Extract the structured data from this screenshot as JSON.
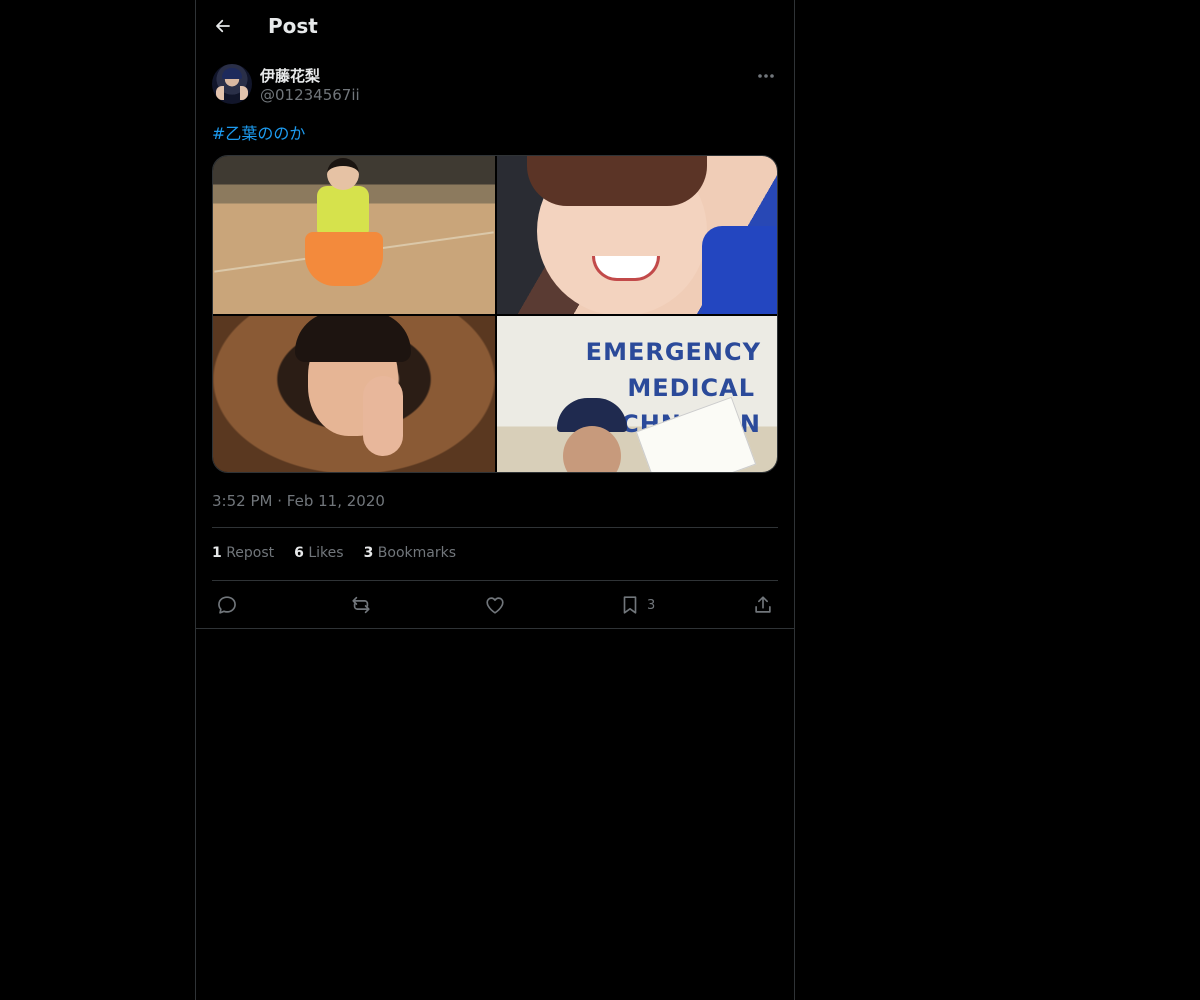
{
  "header": {
    "title": "Post"
  },
  "post": {
    "author": {
      "name": "伊藤花梨",
      "handle": "@01234567ii"
    },
    "hashtag": "#乙葉ののか",
    "media": {
      "photos": [
        {
          "name": "photo-1"
        },
        {
          "name": "photo-2"
        },
        {
          "name": "photo-3"
        },
        {
          "name": "photo-4",
          "visible_text": [
            "EMERGENCY",
            "MEDICAL",
            "ECHNICIAN"
          ]
        }
      ]
    },
    "time": "3:52 PM",
    "separator": "·",
    "date": "Feb 11, 2020",
    "stats": {
      "reposts": {
        "count": "1",
        "label": "Repost"
      },
      "likes": {
        "count": "6",
        "label": "Likes"
      },
      "bookmarks": {
        "count": "3",
        "label": "Bookmarks"
      }
    },
    "actions": {
      "bookmark_count": "3"
    }
  },
  "icons": {
    "back": "arrow-left-icon",
    "more": "more-horizontal-icon",
    "reply": "reply-icon",
    "repost": "repost-icon",
    "like": "heart-icon",
    "bookmark": "bookmark-icon",
    "share": "share-icon"
  },
  "colors": {
    "background": "#000000",
    "text": "#e7e9ea",
    "secondary_text": "#71767b",
    "link": "#1d9bf0",
    "border": "#2f3336"
  }
}
